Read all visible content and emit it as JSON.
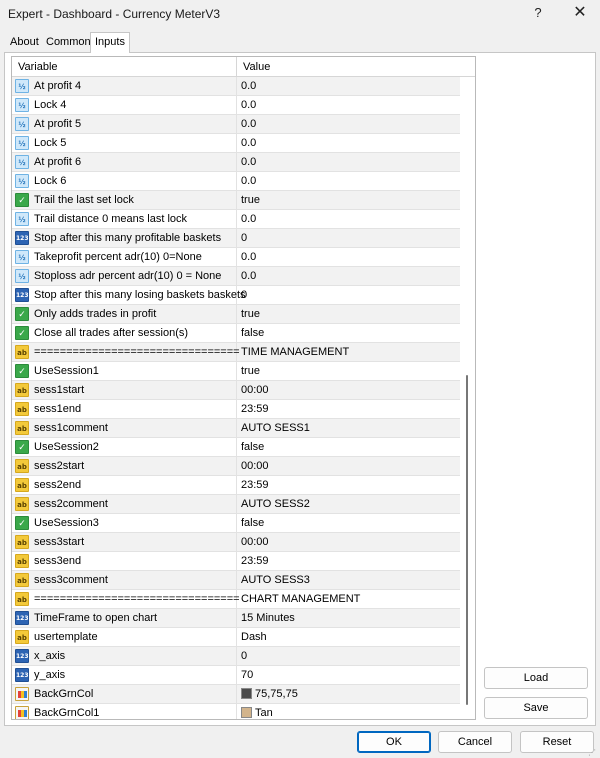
{
  "window": {
    "title": "Expert - Dashboard - Currency MeterV3",
    "help_glyph": "?",
    "close_glyph": "✕"
  },
  "tabs": [
    {
      "label": "About"
    },
    {
      "label": "Common"
    },
    {
      "label": "Inputs"
    }
  ],
  "grid": {
    "col_variable": "Variable",
    "col_value": "Value",
    "rows": [
      {
        "type": "double",
        "name": "At profit 4",
        "value": "0.0"
      },
      {
        "type": "double",
        "name": "Lock 4",
        "value": "0.0"
      },
      {
        "type": "double",
        "name": "At profit 5",
        "value": "0.0"
      },
      {
        "type": "double",
        "name": "Lock 5",
        "value": "0.0"
      },
      {
        "type": "double",
        "name": "At profit 6",
        "value": "0.0"
      },
      {
        "type": "double",
        "name": "Lock 6",
        "value": "0.0"
      },
      {
        "type": "bool",
        "name": "Trail the last set lock",
        "value": "true"
      },
      {
        "type": "double",
        "name": "Trail distance 0 means last lock",
        "value": "0.0"
      },
      {
        "type": "int",
        "name": "Stop after this many profitable baskets",
        "value": "0"
      },
      {
        "type": "double",
        "name": "Takeprofit percent adr(10) 0=None",
        "value": "0.0"
      },
      {
        "type": "double",
        "name": "Stoploss adr percent adr(10) 0 = None",
        "value": "0.0"
      },
      {
        "type": "int",
        "name": "Stop after this many losing baskets baskets",
        "value": "0"
      },
      {
        "type": "bool",
        "name": "Only adds trades in profit",
        "value": "true"
      },
      {
        "type": "bool",
        "name": "Close all trades after session(s)",
        "value": "false"
      },
      {
        "type": "str",
        "name": "================================",
        "value": "TIME MANAGEMENT"
      },
      {
        "type": "bool",
        "name": "UseSession1",
        "value": "true"
      },
      {
        "type": "str",
        "name": "sess1start",
        "value": "00:00"
      },
      {
        "type": "str",
        "name": "sess1end",
        "value": "23:59"
      },
      {
        "type": "str",
        "name": "sess1comment",
        "value": "AUTO SESS1"
      },
      {
        "type": "bool",
        "name": "UseSession2",
        "value": "false"
      },
      {
        "type": "str",
        "name": "sess2start",
        "value": "00:00"
      },
      {
        "type": "str",
        "name": "sess2end",
        "value": "23:59"
      },
      {
        "type": "str",
        "name": "sess2comment",
        "value": "AUTO SESS2"
      },
      {
        "type": "bool",
        "name": "UseSession3",
        "value": "false"
      },
      {
        "type": "str",
        "name": "sess3start",
        "value": "00:00"
      },
      {
        "type": "str",
        "name": "sess3end",
        "value": "23:59"
      },
      {
        "type": "str",
        "name": "sess3comment",
        "value": "AUTO SESS3"
      },
      {
        "type": "str",
        "name": "================================",
        "value": "CHART MANAGEMENT"
      },
      {
        "type": "tf",
        "name": "TimeFrame to open chart",
        "value": "15 Minutes"
      },
      {
        "type": "str",
        "name": "usertemplate",
        "value": "Dash"
      },
      {
        "type": "int",
        "name": "x_axis",
        "value": "0"
      },
      {
        "type": "int",
        "name": "y_axis",
        "value": "70"
      },
      {
        "type": "color",
        "name": "BackGrnCol",
        "value": "75,75,75",
        "swatch": "#4b4b4b"
      },
      {
        "type": "color",
        "name": "BackGrnCol1",
        "value": "Tan",
        "swatch": "#d2b48c"
      }
    ]
  },
  "type_glyphs": {
    "double": "½",
    "int": "123",
    "bool": "✓",
    "str": "ab",
    "tf": "123",
    "color": ""
  },
  "buttons": {
    "load": "Load",
    "save": "Save",
    "ok": "OK",
    "cancel": "Cancel",
    "reset": "Reset"
  }
}
